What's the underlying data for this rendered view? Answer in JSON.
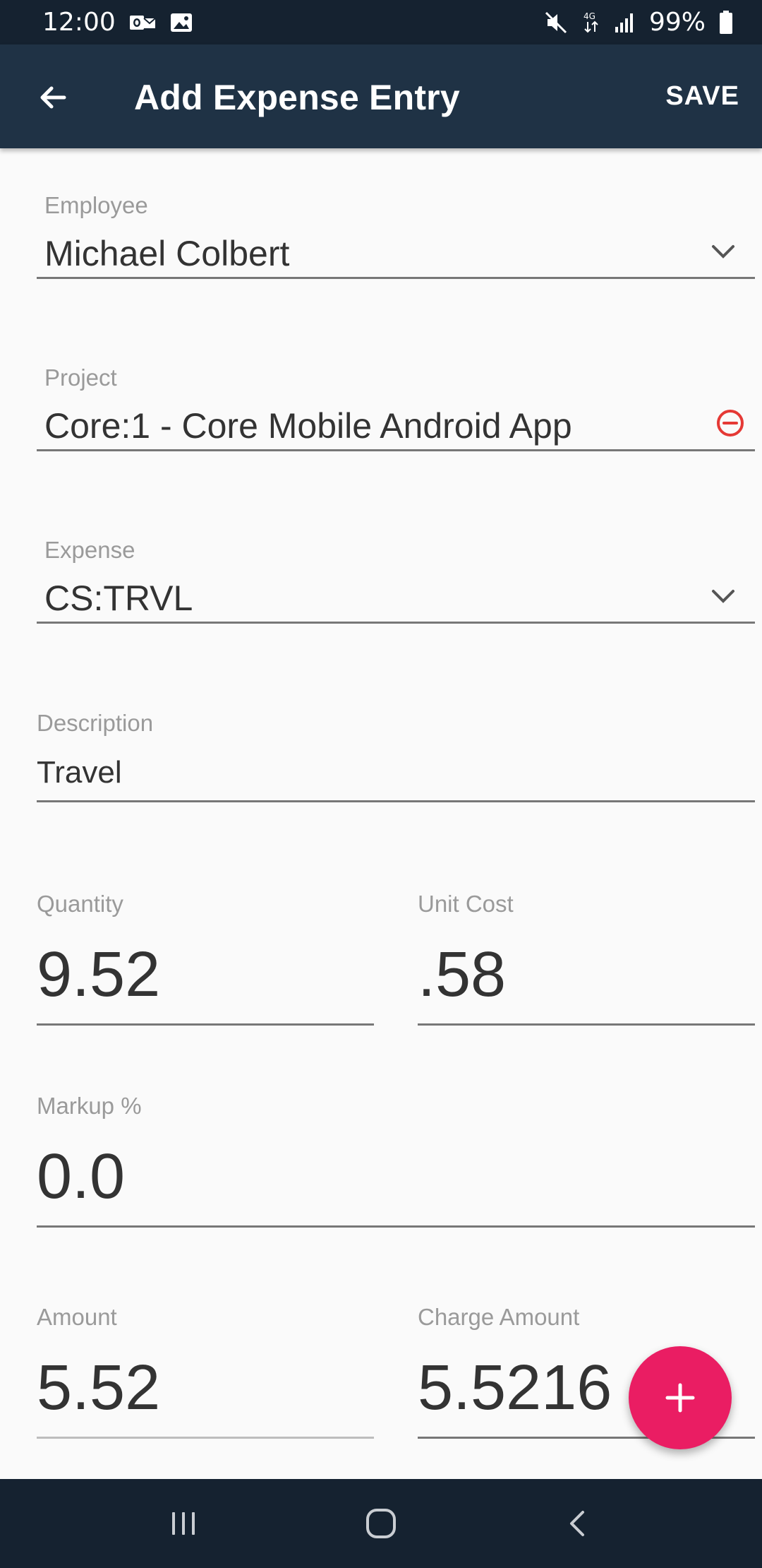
{
  "status_bar": {
    "time": "12:00",
    "battery_percent": "99%",
    "icons": [
      "outlook-icon",
      "gallery-icon",
      "mute-icon",
      "data-4g-icon",
      "signal-icon",
      "battery-icon"
    ]
  },
  "app_bar": {
    "title": "Add Expense Entry",
    "save_label": "SAVE",
    "back_icon": "arrow-back-icon"
  },
  "form": {
    "employee": {
      "label": "Employee",
      "value": "Michael Colbert"
    },
    "project": {
      "label": "Project",
      "value": "Core:1 - Core Mobile Android App"
    },
    "expense": {
      "label": "Expense",
      "value": "CS:TRVL"
    },
    "description": {
      "label": "Description",
      "value": "Travel"
    },
    "quantity": {
      "label": "Quantity",
      "value": "9.52"
    },
    "unit_cost": {
      "label": "Unit Cost",
      "value": ".58"
    },
    "markup": {
      "label": "Markup %",
      "value": "0.0"
    },
    "amount": {
      "label": "Amount",
      "value": "5.52"
    },
    "charge_amount": {
      "label": "Charge Amount",
      "value": "5.5216"
    }
  },
  "fab": {
    "icon": "plus-icon"
  },
  "nav_bar": {
    "icons": [
      "recent-apps-icon",
      "home-icon",
      "back-icon"
    ]
  },
  "colors": {
    "status_bar": "#152230",
    "app_bar": "#1f3245",
    "fab": "#ea1d63",
    "clear_icon": "#e53935",
    "background": "#fafafa"
  }
}
